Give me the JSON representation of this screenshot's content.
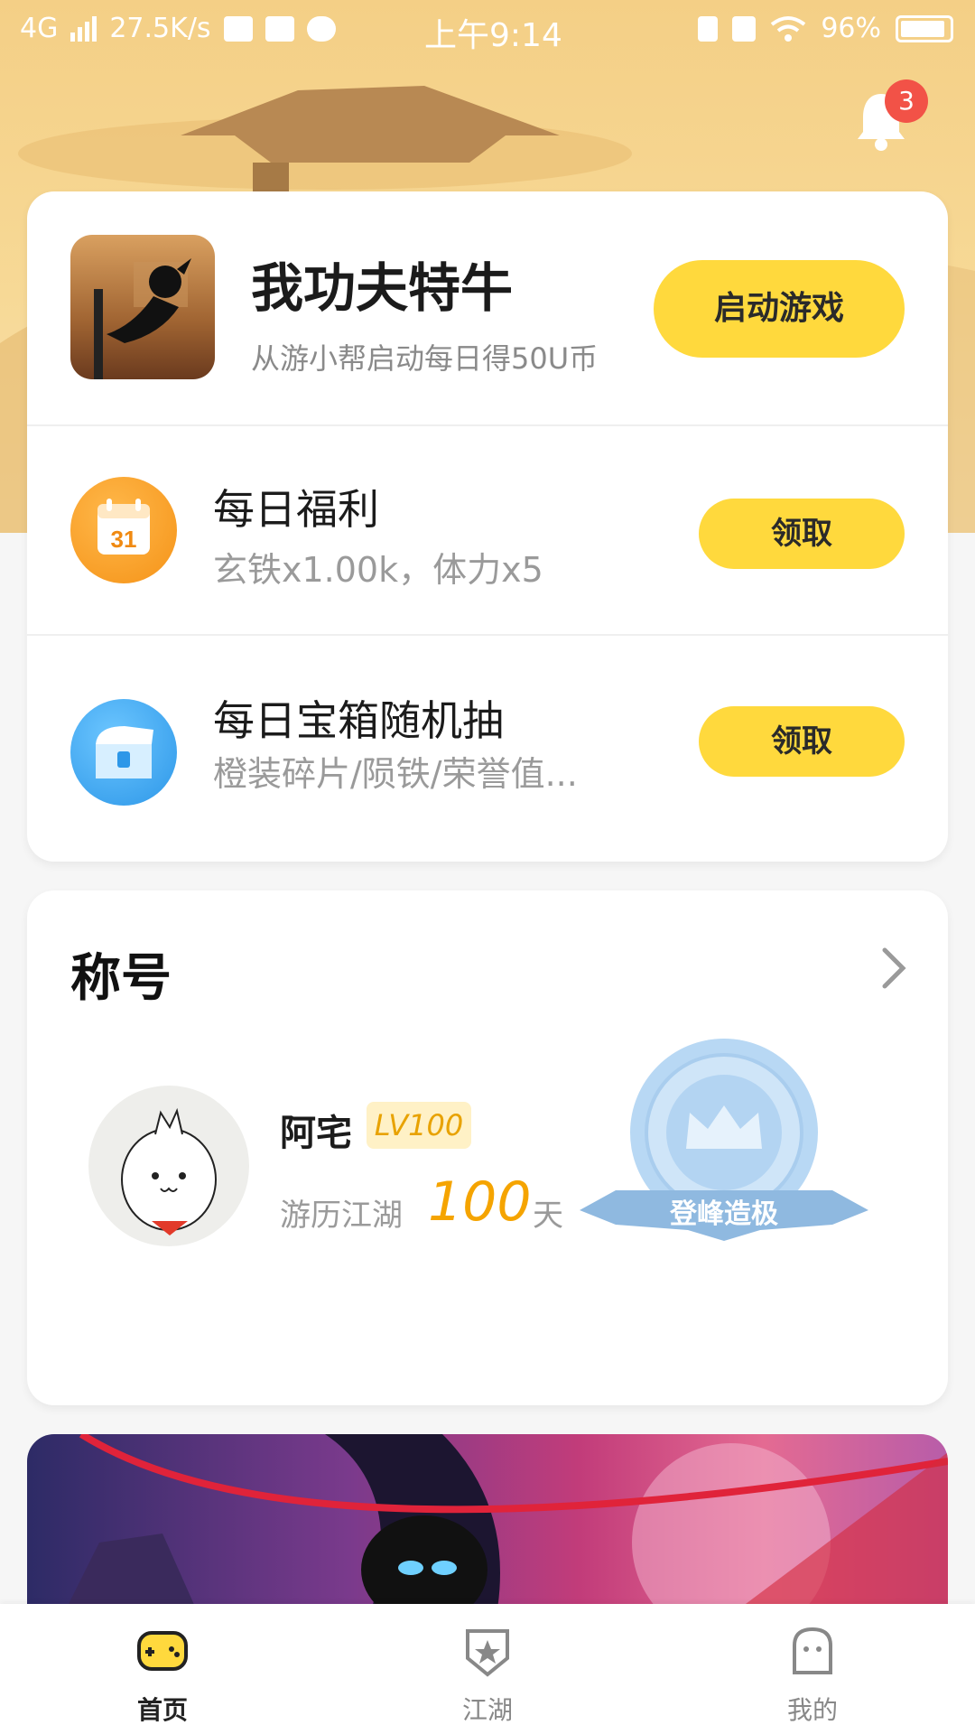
{
  "status_bar": {
    "network": "4G",
    "speed": "27.5K/s",
    "time": "上午9:14",
    "battery": "96%"
  },
  "notifications": {
    "count": "3"
  },
  "game": {
    "title": "我功夫特牛",
    "subtitle": "从游小帮启动每日得50U币",
    "launch_label": "启动游戏"
  },
  "daily_welfare": {
    "title": "每日福利",
    "subtitle": "玄铁x1.00k，体力x5",
    "calendar_day": "31",
    "claim_label": "领取"
  },
  "daily_chest": {
    "title": "每日宝箱随机抽",
    "subtitle": "橙装碎片/陨铁/荣誉值...",
    "claim_label": "领取"
  },
  "title_section": {
    "heading": "称号",
    "user_name": "阿宅",
    "level": "LV100",
    "travel_label": "游历江湖",
    "travel_days": "100",
    "travel_unit": "天",
    "medal_label": "登峰造极"
  },
  "tabs": [
    {
      "label": "首页",
      "active": true
    },
    {
      "label": "江湖",
      "active": false
    },
    {
      "label": "我的",
      "active": false
    }
  ],
  "colors": {
    "accent": "#ffd93d",
    "badge": "#f25247",
    "level_text": "#e8a200",
    "days": "#f5a400"
  }
}
